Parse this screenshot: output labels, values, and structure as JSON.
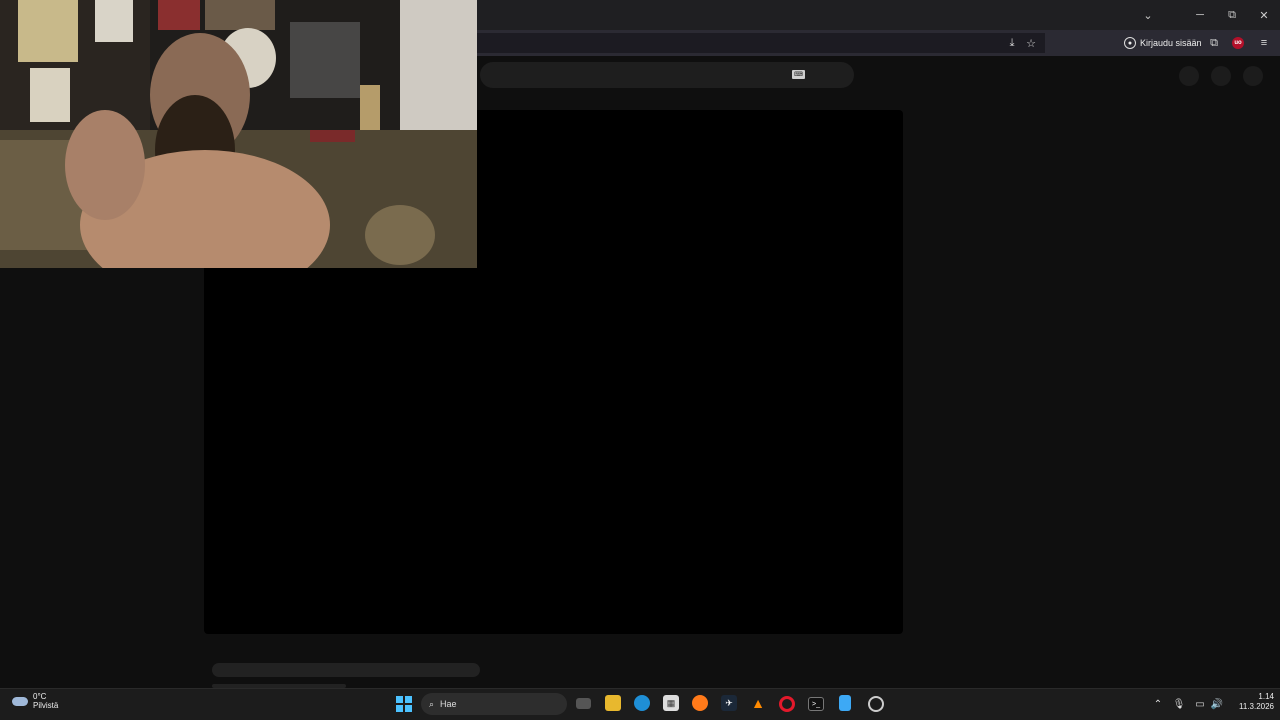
{
  "window": {
    "tab_list_icon": "chevron-down-icon",
    "controls": {
      "minimize": "─",
      "maximize": "⧉",
      "close": "✕"
    }
  },
  "navbar": {
    "signin_label": "Kirjaudu sisään",
    "extension_badge": "uo"
  },
  "page": {
    "search_keyboard_icon": "keyboard-icon"
  },
  "taskbar": {
    "weather": {
      "temperature": "0°C",
      "condition": "Pilvistä"
    },
    "search_placeholder": "Hae",
    "apps": [
      "task-view",
      "file-explorer",
      "edge",
      "store",
      "firefox",
      "steam",
      "vlc",
      "opera",
      "terminal",
      "notepad",
      "chatgpt"
    ],
    "time": "1.14",
    "date": "11.3.2026"
  },
  "colors": {
    "accent": "#4cc2ff",
    "page_bg": "#0f0f0f",
    "badge_red": "#b3102a"
  }
}
